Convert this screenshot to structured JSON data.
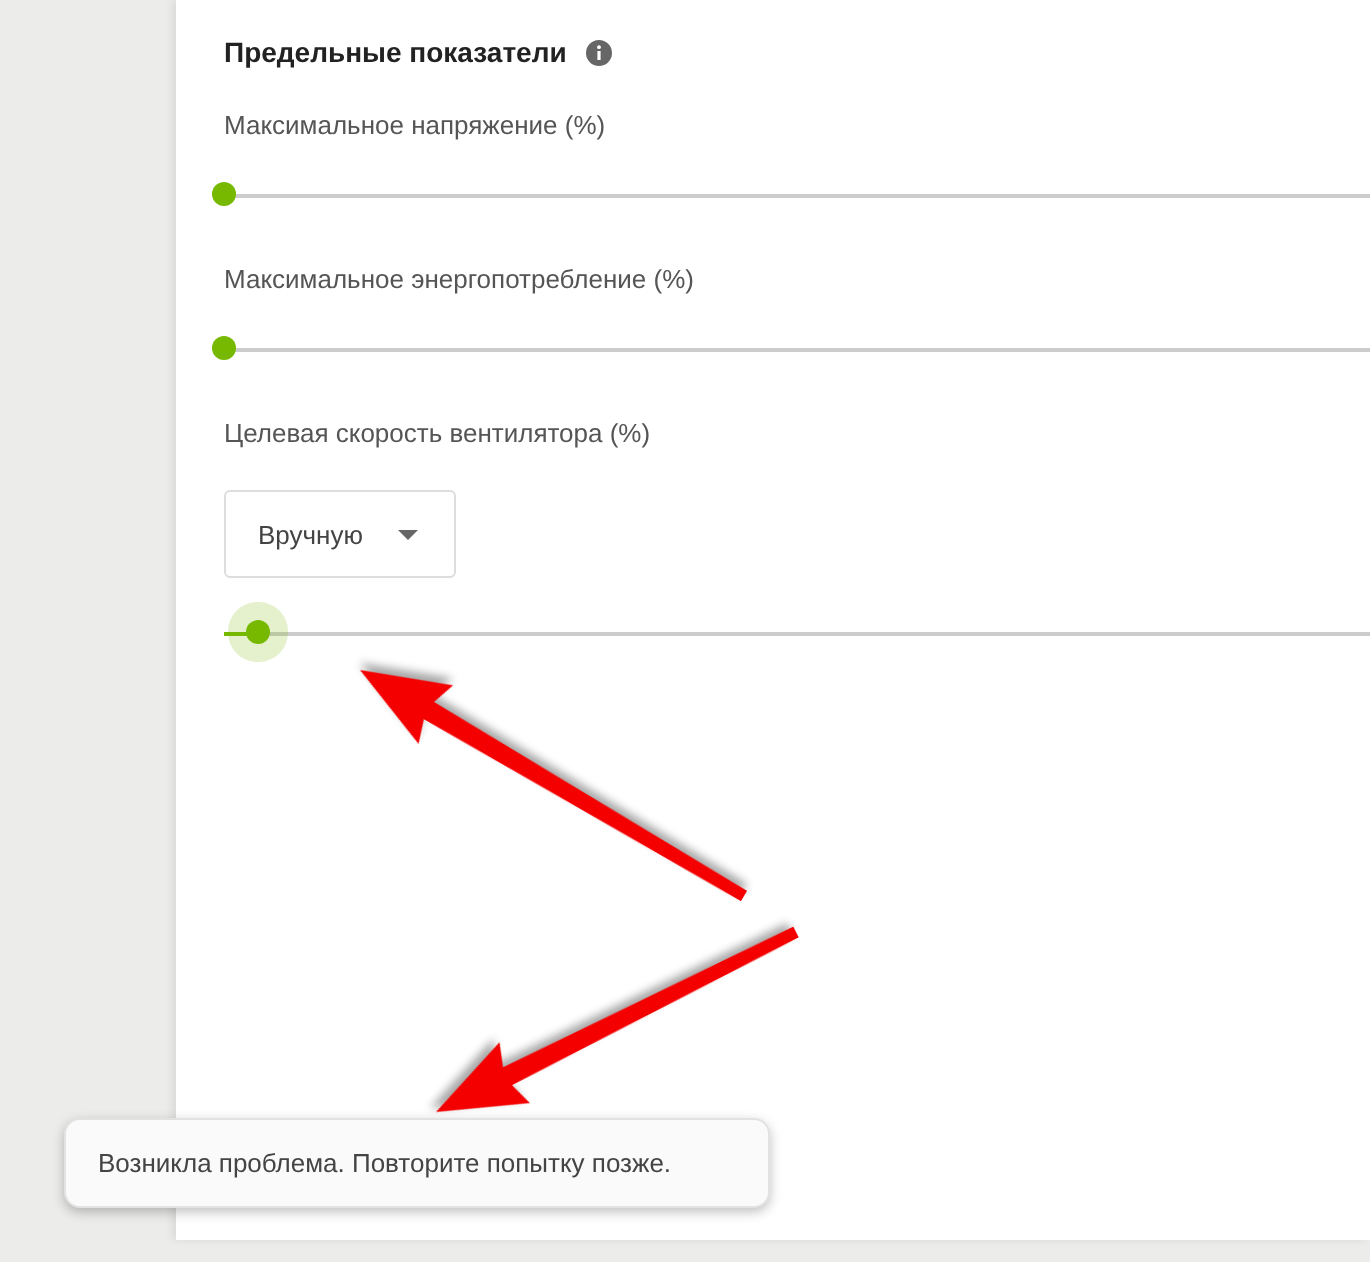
{
  "section": {
    "title": "Предельные показатели",
    "info_icon": true
  },
  "settings": [
    {
      "kind": "slider",
      "label": "Максимальное напряжение (%)",
      "level": 0,
      "focused": false
    },
    {
      "kind": "slider",
      "label": "Максимальное энергопотребление (%)",
      "level": 0,
      "focused": false
    },
    {
      "kind": "select-slider",
      "label": "Целевая скорость вентилятора (%)",
      "select": {
        "value": "Вручную"
      },
      "level": 0.03,
      "focused": true
    }
  ],
  "toast": {
    "message": "Возникла проблема. Повторите попытку позже."
  },
  "annotations": [
    {
      "kind": "arrow"
    },
    {
      "kind": "arrow"
    }
  ]
}
